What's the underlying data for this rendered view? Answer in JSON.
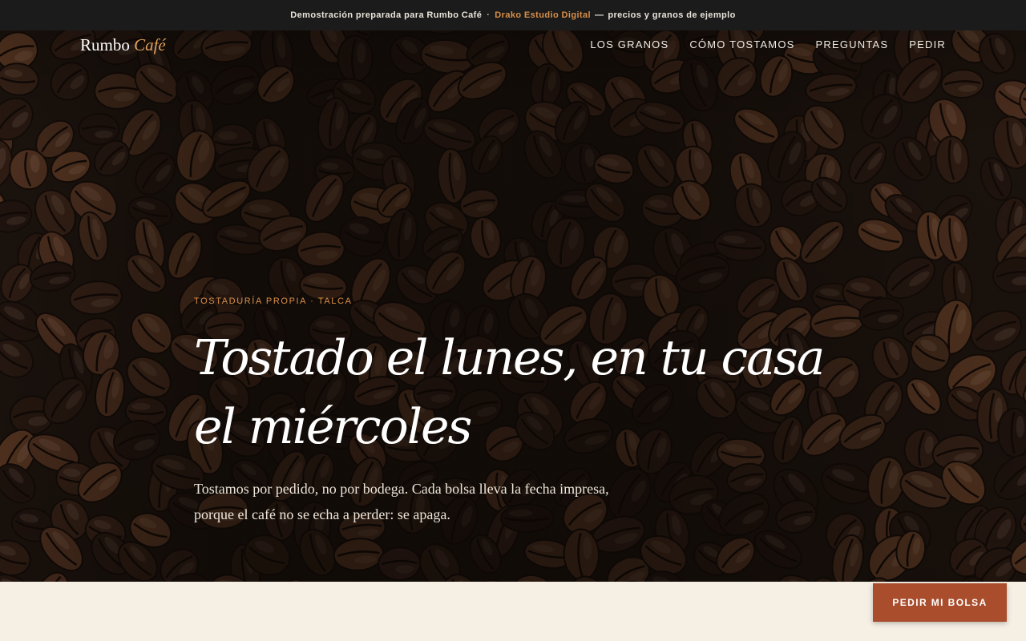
{
  "banner": {
    "text": "Demostración preparada para Rumbo Café",
    "separator": "·",
    "studio": "Drako Estudio Digital",
    "dash": "—",
    "suffix": "precios y granos de ejemplo"
  },
  "brand": {
    "name": "Rumbo",
    "accent": "Café"
  },
  "nav": {
    "items": [
      {
        "label": "LOS GRANOS"
      },
      {
        "label": "CÓMO TOSTAMOS"
      },
      {
        "label": "PREGUNTAS"
      },
      {
        "label": "PEDIR"
      }
    ]
  },
  "hero": {
    "eyebrow": "TOSTADURÍA PROPIA · TALCA",
    "headline": "Tostado el lunes, en tu casa el miércoles",
    "lede": "Tostamos por pedido, no por bodega. Cada bolsa lleva la fecha impresa, porque el café no se echa a perder: se apaga.",
    "background": "coffee-beans-photo"
  },
  "cta": {
    "label": "PEDIR MI BOLSA"
  },
  "colors": {
    "accent": "#d98f48",
    "button": "#a94d2d",
    "topbar": "#1b1b1b",
    "cream": "#f5efe4"
  }
}
